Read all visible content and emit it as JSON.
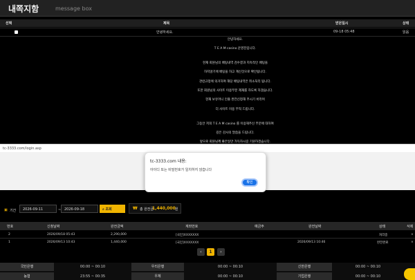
{
  "header": {
    "title": "내쪽지함",
    "subtitle": "message box"
  },
  "messages": {
    "columns": [
      "선택",
      "제목",
      "받은일시",
      "상태"
    ],
    "rows": [
      {
        "title": "안녕하세요.",
        "date": "09-18 05:48",
        "status": "읽음"
      }
    ],
    "body": [
      "안녕하세요.",
      "T E A M casino 운영진입니다.",
      "현재 회원님의 배팅내역 검수결과 지속적인 배팅을",
      "하지않기에 배팅을 하고 계신것으로 확인됩니다.",
      "관련규정에 의거하여 해당 배팅내역은 취소처리 됩니다.",
      "또한 회원님의 사이트 이용부분 제재를 하도록 하겠습니다.",
      "현재 보유머니 인출 완전신청해 주시기 바라며",
      "더 사이트 이용 부적 드립니다.",
      "그동안 저희 T E A M casino 를 이용해주신 부분에 대하여",
      "깊은 감사의 말씀을 드립니다.",
      "앞으로 회원님께 좋은일만 가득하시길 기원하겠습니다."
    ]
  },
  "browser": {
    "url": "tc-3333.com/login.asp"
  },
  "alert": {
    "title": "tc-3333.com 내용:",
    "message": "아이디 또는 비밀번호가 일치하지 않습니다",
    "ok_label": "확인"
  },
  "filter": {
    "label": "기간",
    "from": "2026-09-11",
    "sep": "~",
    "to": "2026-09-18",
    "search_label": "조회",
    "total_label": "총 완전금",
    "total_value": "1,440,000",
    "total_unit": "원"
  },
  "deposits": {
    "columns": [
      "번호",
      "신청날짜",
      "완전금액",
      "계좌번호",
      "예금주",
      "완전날짜",
      "상태",
      "삭제"
    ],
    "rows": [
      {
        "no": "2",
        "date": "2026/09/18 05:43",
        "amount": "2,290,000",
        "account": "[국민]XXXXXXX",
        "holder": "",
        "done_date": "",
        "status": "처리중"
      },
      {
        "no": "1",
        "date": "2026/09/13 10:43",
        "amount": "1,440,000",
        "account": "[국민]XXXXXXX",
        "holder": "",
        "done_date": "2026/09/13 10:46",
        "status": "완전완료"
      }
    ]
  },
  "pager": {
    "prev": "‹",
    "current": "1",
    "next": "›"
  },
  "bank_hours": {
    "rows": [
      [
        {
          "bank": "국민은행",
          "time": "00:00 ~ 00:10"
        },
        {
          "bank": "우리은행",
          "time": "00:00 ~ 00:10"
        },
        {
          "bank": "신한은행",
          "time": "00:00 ~ 00:10"
        }
      ],
      [
        {
          "bank": "농협",
          "time": "23:55 ~ 00:35"
        },
        {
          "bank": "우체",
          "time": "00:00 ~ 00:10"
        },
        {
          "bank": "기업은행",
          "time": "00:00 ~ 00:10"
        }
      ]
    ]
  },
  "colors": {
    "accent": "#f0b400",
    "button_blue": "#1a73e8"
  }
}
